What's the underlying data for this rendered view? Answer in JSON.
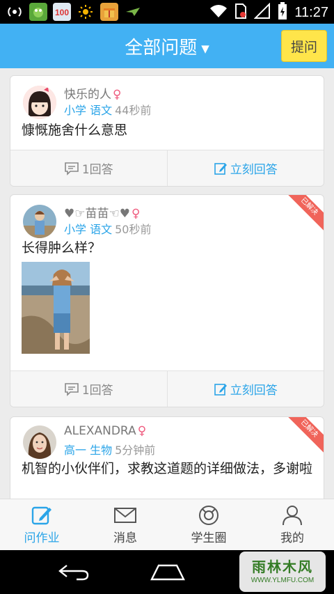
{
  "status_bar": {
    "time": "11:27",
    "app_icons": [
      "signal-tower-icon",
      "frog-app-icon",
      "100-app-icon",
      "sun-icon",
      "gift-box-icon",
      "plane-icon"
    ],
    "system_icons": [
      "wifi-icon",
      "sim-card-icon",
      "cell-signal-icon",
      "battery-icon"
    ]
  },
  "header": {
    "title": "全部问题",
    "ask_button": "提问"
  },
  "cards": [
    {
      "user": "快乐的人",
      "gender_symbol": "♀",
      "subject": "小学 语文",
      "time": "44秒前",
      "question": "慷慨施舍什么意思",
      "answers": "1回答",
      "answer_now": "立刻回答",
      "solved": false
    },
    {
      "user": "♥☞苗苗☜♥",
      "gender_symbol": "♀",
      "subject": "小学 语文",
      "time": "50秒前",
      "question": "长得肿么样？",
      "answers": "1回答",
      "answer_now": "立刻回答",
      "solved": true,
      "solved_label": "已解决",
      "has_photo": true
    },
    {
      "user": "ALEXANDRA",
      "gender_symbol": "♀",
      "subject": "高一 生物",
      "time": "5分钟前",
      "question": "机智的小伙伴们，求教这道题的详细做法，多谢啦",
      "solved": true,
      "solved_label": "已解决"
    }
  ],
  "tabs": [
    {
      "label": "问作业",
      "icon": "edit-icon",
      "active": true
    },
    {
      "label": "消息",
      "icon": "envelope-icon",
      "active": false
    },
    {
      "label": "学生圈",
      "icon": "circle-icon",
      "active": false
    },
    {
      "label": "我的",
      "icon": "person-icon",
      "active": false
    }
  ],
  "watermark": {
    "title": "雨林木风",
    "url": "WWW.YLMFU.COM"
  },
  "colors": {
    "primary": "#42b1f3",
    "accent_yellow": "#ffe54a",
    "link_blue": "#2aa4e8",
    "female_pink": "#ef5b7e",
    "solved_red": "#f0645a"
  }
}
